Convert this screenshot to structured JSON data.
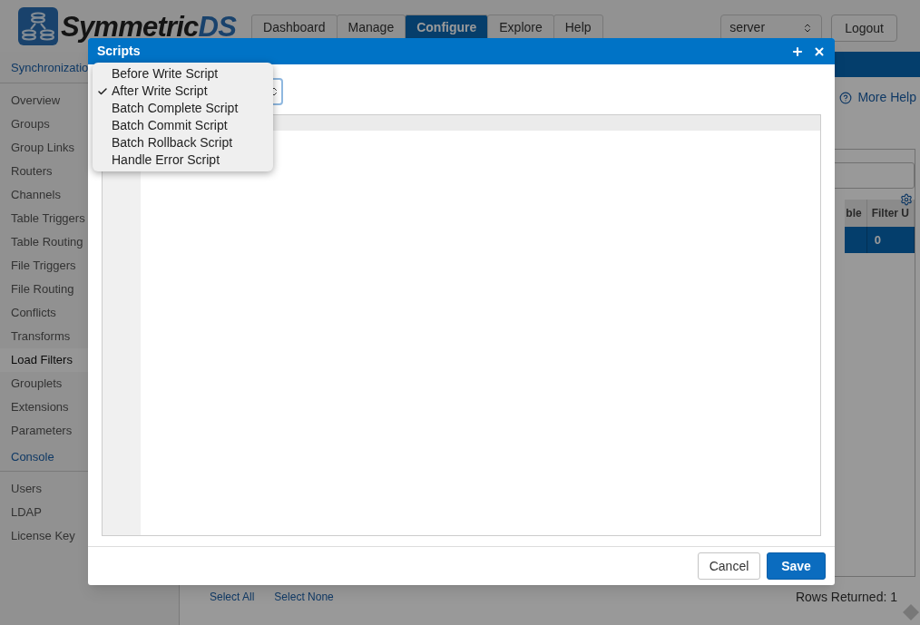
{
  "logo": {
    "name": "Symmetric",
    "suffix": "DS"
  },
  "nav_tabs": [
    {
      "label": "Dashboard",
      "selected": false
    },
    {
      "label": "Manage",
      "selected": false
    },
    {
      "label": "Configure",
      "selected": true
    },
    {
      "label": "Explore",
      "selected": false
    },
    {
      "label": "Help",
      "selected": false
    }
  ],
  "node_select": {
    "value": "server"
  },
  "logout_button": "Logout",
  "sidebar": {
    "sections": [
      {
        "title": "Synchronizatio",
        "items": [
          {
            "label": "Overview",
            "selected": false
          },
          {
            "label": "Groups",
            "selected": false
          },
          {
            "label": "Group Links",
            "selected": false
          },
          {
            "label": "Routers",
            "selected": false
          },
          {
            "label": "Channels",
            "selected": false
          },
          {
            "label": "Table Triggers",
            "selected": false
          },
          {
            "label": "Table Routing",
            "selected": false
          },
          {
            "label": "File Triggers",
            "selected": false
          },
          {
            "label": "File Routing",
            "selected": false
          },
          {
            "label": "Conflicts",
            "selected": false
          },
          {
            "label": "Transforms",
            "selected": false
          },
          {
            "label": "Load Filters",
            "selected": true
          },
          {
            "label": "Grouplets",
            "selected": false
          },
          {
            "label": "Extensions",
            "selected": false
          },
          {
            "label": "Parameters",
            "selected": false
          }
        ]
      },
      {
        "title": "Console",
        "items": [
          {
            "label": "Users",
            "selected": false
          },
          {
            "label": "LDAP",
            "selected": false
          },
          {
            "label": "License Key",
            "selected": false
          }
        ]
      }
    ]
  },
  "more_help_link": "More Help",
  "table": {
    "columns": [
      "ble",
      "Filter U"
    ],
    "rows": [
      {
        "cells": [
          "",
          "0"
        ],
        "selected": true
      }
    ]
  },
  "footer_links": [
    "Select All",
    "Select None"
  ],
  "rows_returned": "Rows Returned: 1",
  "dialog": {
    "title": "Scripts",
    "script_menu": [
      {
        "label": "Before Write Script",
        "selected": false
      },
      {
        "label": "After Write Script",
        "selected": true
      },
      {
        "label": "Batch Complete Script",
        "selected": false
      },
      {
        "label": "Batch Commit Script",
        "selected": false
      },
      {
        "label": "Batch Rollback Script",
        "selected": false
      },
      {
        "label": "Handle Error Script",
        "selected": false
      }
    ],
    "buttons": [
      {
        "label": "Cancel",
        "kind": "secondary"
      },
      {
        "label": "Save",
        "kind": "primary"
      }
    ]
  }
}
